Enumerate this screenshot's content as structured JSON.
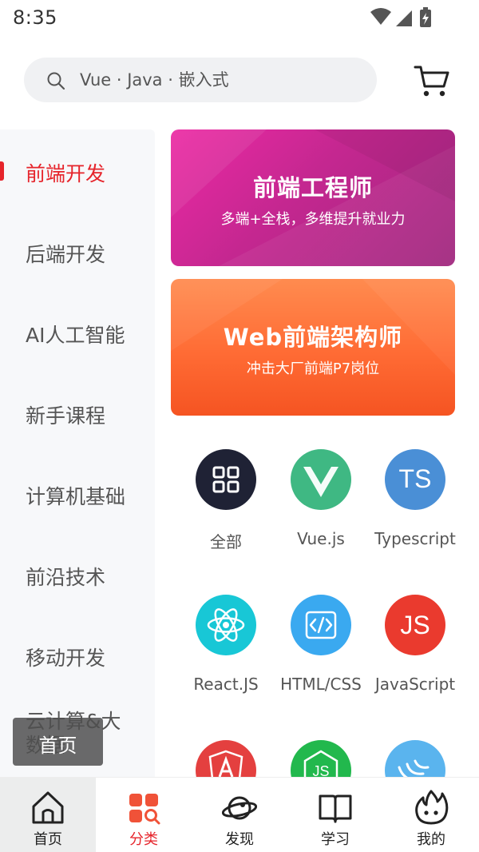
{
  "status_bar": {
    "time": "8:35"
  },
  "search": {
    "placeholder": "Vue · Java · 嵌入式"
  },
  "sidebar": {
    "items": [
      {
        "label": "前端开发",
        "active": true
      },
      {
        "label": "后端开发"
      },
      {
        "label": "AI人工智能"
      },
      {
        "label": "新手课程"
      },
      {
        "label": "计算机基础"
      },
      {
        "label": "前沿技术"
      },
      {
        "label": "移动开发"
      },
      {
        "label": "云计算&大数据"
      }
    ]
  },
  "banners": [
    {
      "title": "前端工程师",
      "subtitle": "多端+全栈，多维提升就业力"
    },
    {
      "title": "Web前端架构师",
      "subtitle": "冲击大厂前端P7岗位"
    }
  ],
  "categories": [
    {
      "label": "全部",
      "icon": "grid-icon",
      "color": "#1f2235"
    },
    {
      "label": "Vue.js",
      "icon": "vue-icon",
      "color": "#3fb883"
    },
    {
      "label": "Typescript",
      "icon": "typescript-icon",
      "color": "#4a8fd6",
      "badge": "TS"
    },
    {
      "label": "React.JS",
      "icon": "react-icon",
      "color": "#18c7d6"
    },
    {
      "label": "HTML/CSS",
      "icon": "html-code-icon",
      "color": "#3aa9f0"
    },
    {
      "label": "JavaScript",
      "icon": "javascript-icon",
      "color": "#ea3a2e",
      "badge": "JS"
    },
    {
      "label": "",
      "icon": "angular-icon",
      "color": "#e4403f"
    },
    {
      "label": "",
      "icon": "nodejs-icon",
      "color": "#22b84d"
    },
    {
      "label": "",
      "icon": "jquery-icon",
      "color": "#5ab4ee"
    }
  ],
  "toast": {
    "text": "首页"
  },
  "bottom_nav": {
    "items": [
      {
        "label": "首页",
        "icon": "home-icon"
      },
      {
        "label": "分类",
        "icon": "category-icon",
        "active": true
      },
      {
        "label": "发现",
        "icon": "planet-icon"
      },
      {
        "label": "学习",
        "icon": "book-icon"
      },
      {
        "label": "我的",
        "icon": "flame-face-icon"
      }
    ]
  },
  "colors": {
    "accent": "#e6242b",
    "sidebar_bg": "#f7f8fa",
    "search_bg": "#f0f1f3"
  }
}
